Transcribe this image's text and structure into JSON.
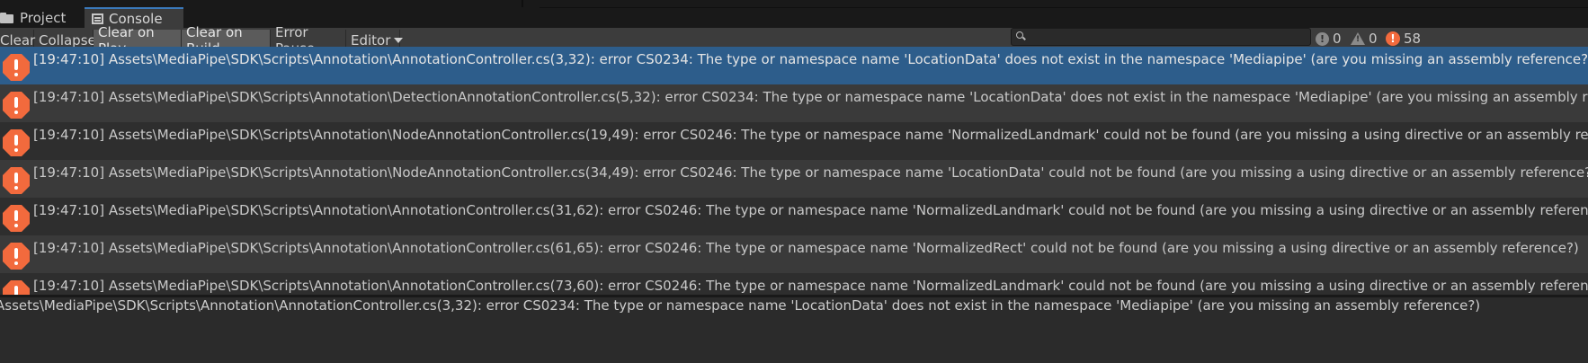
{
  "tabs": [
    {
      "label": "Project",
      "icon": "folder-icon",
      "active": false
    },
    {
      "label": "Console",
      "icon": "console-icon",
      "active": true
    }
  ],
  "toolbar": {
    "clear": "Clear",
    "collapse": "Collapse",
    "clear_on_play": "Clear on Play",
    "clear_on_build": "Clear on Build",
    "error_pause": "Error Pause",
    "editor": "Editor"
  },
  "search": {
    "value": "",
    "placeholder": ""
  },
  "counters": {
    "info": "0",
    "warning": "0",
    "error": "58"
  },
  "colors": {
    "accent": "#3a79bb",
    "selected_row": "#2d5d8b",
    "error_icon": "#f26a3d"
  },
  "log": [
    {
      "text": "[19:47:10] Assets\\MediaPipe\\SDK\\Scripts\\Annotation\\AnnotationController.cs(3,32): error CS0234: The type or namespace name 'LocationData' does not exist in the namespace 'Mediapipe' (are you missing an assembly reference?)",
      "selected": true
    },
    {
      "text": "[19:47:10] Assets\\MediaPipe\\SDK\\Scripts\\Annotation\\DetectionAnnotationController.cs(5,32): error CS0234: The type or namespace name 'LocationData' does not exist in the namespace 'Mediapipe' (are you missing an assembly reference?)",
      "selected": false
    },
    {
      "text": "[19:47:10] Assets\\MediaPipe\\SDK\\Scripts\\Annotation\\NodeAnnotationController.cs(19,49): error CS0246: The type or namespace name 'NormalizedLandmark' could not be found (are you missing a using directive or an assembly reference?)",
      "selected": false
    },
    {
      "text": "[19:47:10] Assets\\MediaPipe\\SDK\\Scripts\\Annotation\\NodeAnnotationController.cs(34,49): error CS0246: The type or namespace name 'LocationData' could not be found (are you missing a using directive or an assembly reference?)",
      "selected": false
    },
    {
      "text": "[19:47:10] Assets\\MediaPipe\\SDK\\Scripts\\Annotation\\AnnotationController.cs(31,62): error CS0246: The type or namespace name 'NormalizedLandmark' could not be found (are you missing a using directive or an assembly reference?)",
      "selected": false
    },
    {
      "text": "[19:47:10] Assets\\MediaPipe\\SDK\\Scripts\\Annotation\\AnnotationController.cs(61,65): error CS0246: The type or namespace name 'NormalizedRect' could not be found (are you missing a using directive or an assembly reference?)",
      "selected": false
    },
    {
      "text": "[19:47:10] Assets\\MediaPipe\\SDK\\Scripts\\Annotation\\AnnotationController.cs(73,60): error CS0246: The type or namespace name 'NormalizedLandmark' could not be found (are you missing a using directive or an assembly reference?)",
      "selected": false
    }
  ],
  "detail": {
    "text": "Assets\\MediaPipe\\SDK\\Scripts\\Annotation\\AnnotationController.cs(3,32): error CS0234: The type or namespace name 'LocationData' does not exist in the namespace 'Mediapipe' (are you missing an assembly reference?)"
  }
}
